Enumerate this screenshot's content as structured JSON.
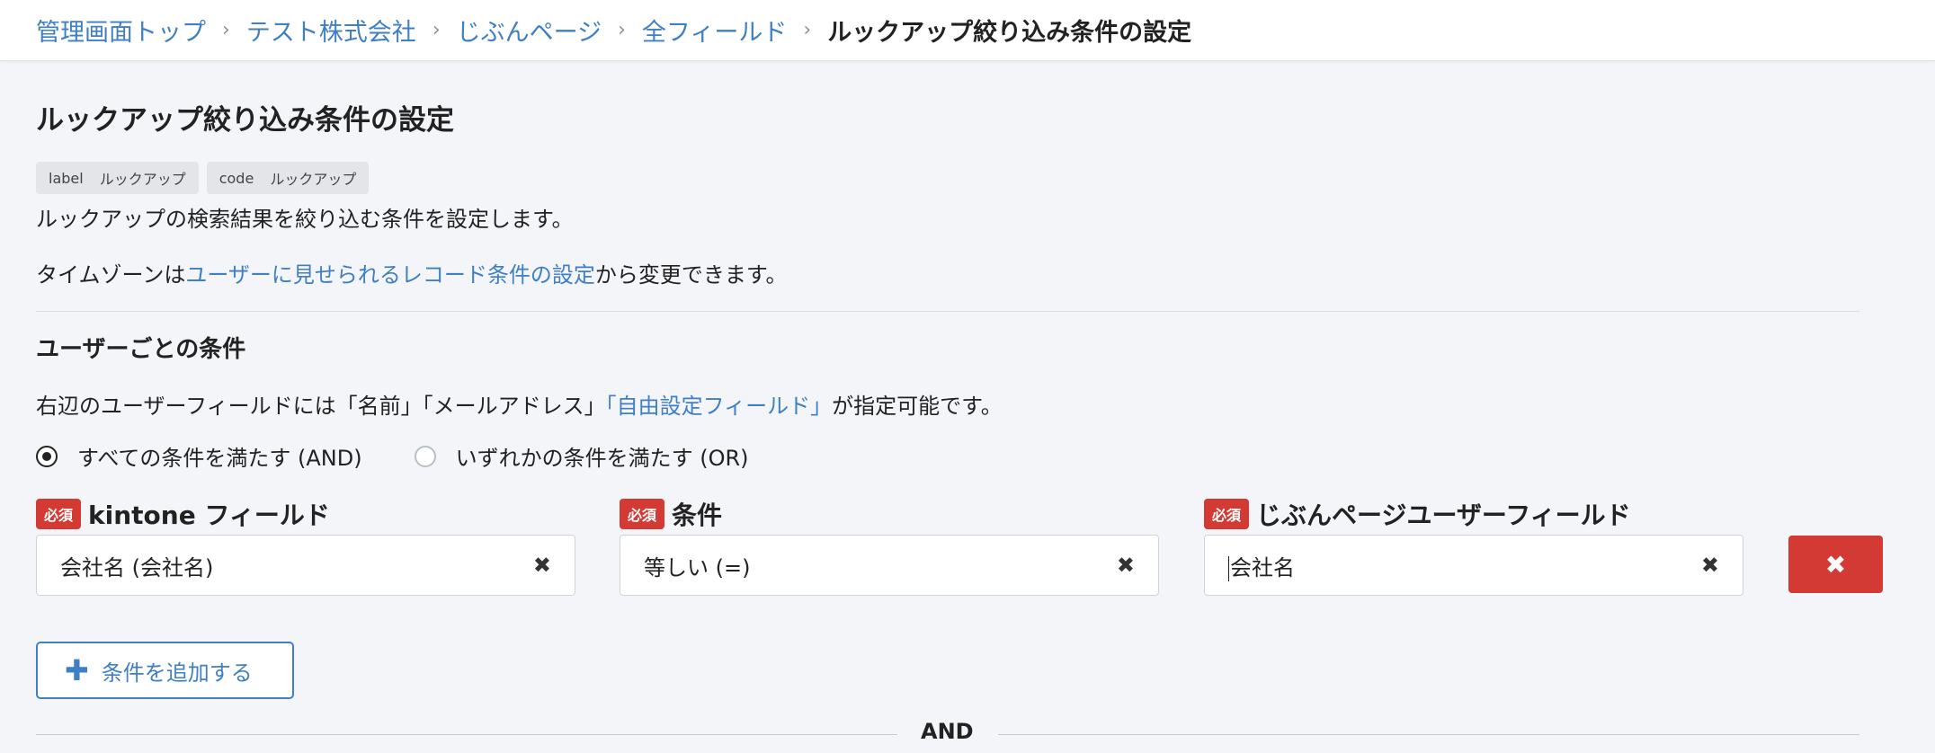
{
  "breadcrumb": {
    "items": [
      "管理画面トップ",
      "テスト株式会社",
      "じぶんページ",
      "全フィールド"
    ],
    "current": "ルックアップ絞り込み条件の設定",
    "separator": "›"
  },
  "page": {
    "title": "ルックアップ絞り込み条件の設定",
    "chips": [
      {
        "key": "label",
        "value": "ルックアップ"
      },
      {
        "key": "code",
        "value": "ルックアップ"
      }
    ],
    "description": "ルックアップの検索結果を絞り込む条件を設定します。",
    "timezone_prefix": "タイムゾーンは",
    "timezone_link": "ユーザーに見せられるレコード条件の設定",
    "timezone_suffix": "から変更できます。"
  },
  "user_conditions": {
    "title": "ユーザーごとの条件",
    "note_prefix": "右辺のユーザーフィールドには「名前」「メールアドレス」",
    "note_link": "「自由設定フィールド」",
    "note_suffix": "が指定可能です。",
    "radio_and": "すべての条件を満たす (AND)",
    "radio_or": "いずれかの条件を満たす (OR)",
    "selected": "AND",
    "required_badge": "必須",
    "field_label": "kintone フィールド",
    "condition_label": "条件",
    "user_field_label": "じぶんページユーザーフィールド",
    "rows": [
      {
        "field": "会社名 (会社名)",
        "condition": "等しい (=)",
        "user_field": "会社名"
      }
    ],
    "clear_symbol": "✖",
    "delete_symbol": "✖",
    "add_button_label": "条件を追加する",
    "add_symbol": "✚",
    "joiner": "AND"
  },
  "colors": {
    "link": "#3f7fc4",
    "required": "#d23a33",
    "background": "#f3f5f9"
  }
}
